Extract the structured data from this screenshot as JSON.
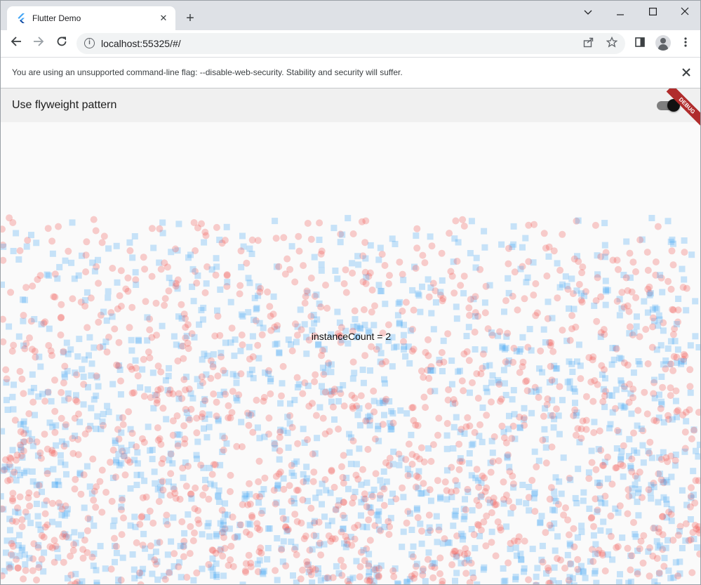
{
  "browser": {
    "tab_title": "Flutter Demo",
    "url": "localhost:55325/#/",
    "infobar_text": "You are using an unsupported command-line flag: --disable-web-security. Stability and security will suffer."
  },
  "app": {
    "title": "Use flyweight pattern",
    "switch_on": true,
    "debug_banner": "DEBUG",
    "instance_count_label": "instanceCount = 2"
  },
  "colors": {
    "circle": "#ef5350",
    "square": "#42a5f5",
    "debug": "#b02c2c"
  },
  "icons": [
    "flutter-icon",
    "close-icon",
    "plus-icon",
    "chevron-down-icon",
    "minimize-icon",
    "maximize-icon",
    "back-icon",
    "forward-icon",
    "reload-icon",
    "info-icon",
    "share-icon",
    "star-icon",
    "side-panel-icon",
    "profile-icon",
    "more-icon"
  ]
}
